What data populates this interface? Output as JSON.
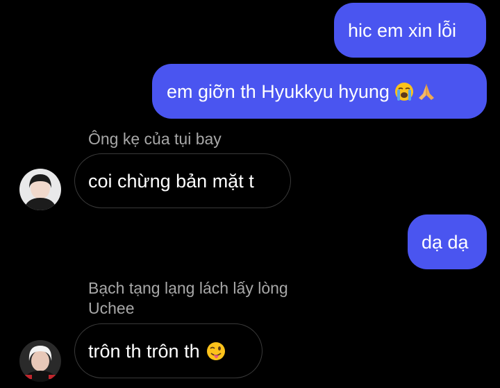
{
  "messages": [
    {
      "id": "m1",
      "direction": "sent",
      "text": "hic em xin lỗi"
    },
    {
      "id": "m2",
      "direction": "sent",
      "text": "em giỡn th Hyukkyu hyung",
      "emojis": [
        "loudly-crying-face",
        "folded-hands"
      ]
    },
    {
      "id": "m3",
      "direction": "received",
      "sender": "Ông kẹ của tụi bay",
      "text": "coi chừng bản mặt t"
    },
    {
      "id": "m4",
      "direction": "sent",
      "text": "dạ dạ"
    },
    {
      "id": "m5",
      "direction": "received",
      "sender": "Bạch tạng lạng lách lấy lòng Uchee",
      "text": "trôn th trôn th",
      "emojis": [
        "winking-face-with-tongue"
      ]
    }
  ],
  "colors": {
    "background": "#000000",
    "sent_bubble": "#4a55f0",
    "received_border": "#3a3a3a",
    "sender_name": "#a8a8a8",
    "text": "#ffffff"
  }
}
